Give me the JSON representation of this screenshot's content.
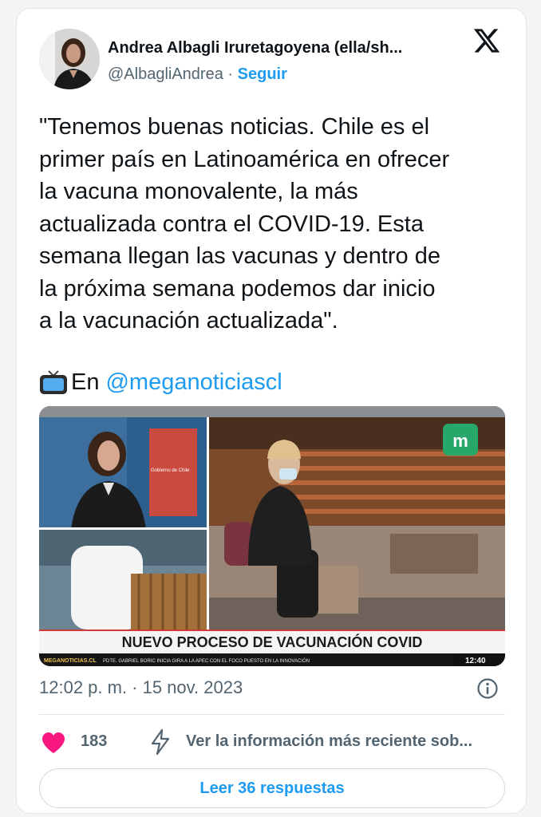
{
  "author": {
    "name": "Andrea Albagli Iruretagoyena (ella/sh...",
    "handle": "@AlbagliAndrea",
    "separator": "·",
    "follow_label": "Seguir"
  },
  "brand_icon": "x-logo-icon",
  "tweet": {
    "text": "\"Tenemos buenas noticias. Chile es el\nprimer país en Latinoamérica en ofrecer\nla vacuna monovalente, la más\nactualizada contra el COVID-19. Esta\nsemana llegan las vacunas y dentro de\nla próxima semana podemos dar inicio\na la vacunación actualizada\".",
    "source_prefix": "En",
    "source_mention": "@meganoticiascl",
    "source_icon": "tv-emoji-icon"
  },
  "media": {
    "lower_third_headline": "NUEVO PROCESO DE VACUNACIÓN COVID",
    "ticker_site": "MEGANOTICIAS.CL",
    "ticker_text": "PDTE. GABRIEL BORIC INICIA GIRA A LA APEC CON EL FOCO PUESTO EN LA INNOVACIÓN",
    "ticker_time": "12:40",
    "backdrop_text": "Gobierno de Chile"
  },
  "meta": {
    "timestamp": "12:02 p. m. · 15 nov. 2023",
    "info_icon": "info-icon"
  },
  "actions": {
    "like_count": "183",
    "latest_info_label": "Ver la información más reciente sob...",
    "replies_button": "Leer 36 respuestas"
  },
  "colors": {
    "accent": "#1d9bf0",
    "like": "#f91880",
    "muted": "#536471",
    "text": "#0f1419"
  }
}
